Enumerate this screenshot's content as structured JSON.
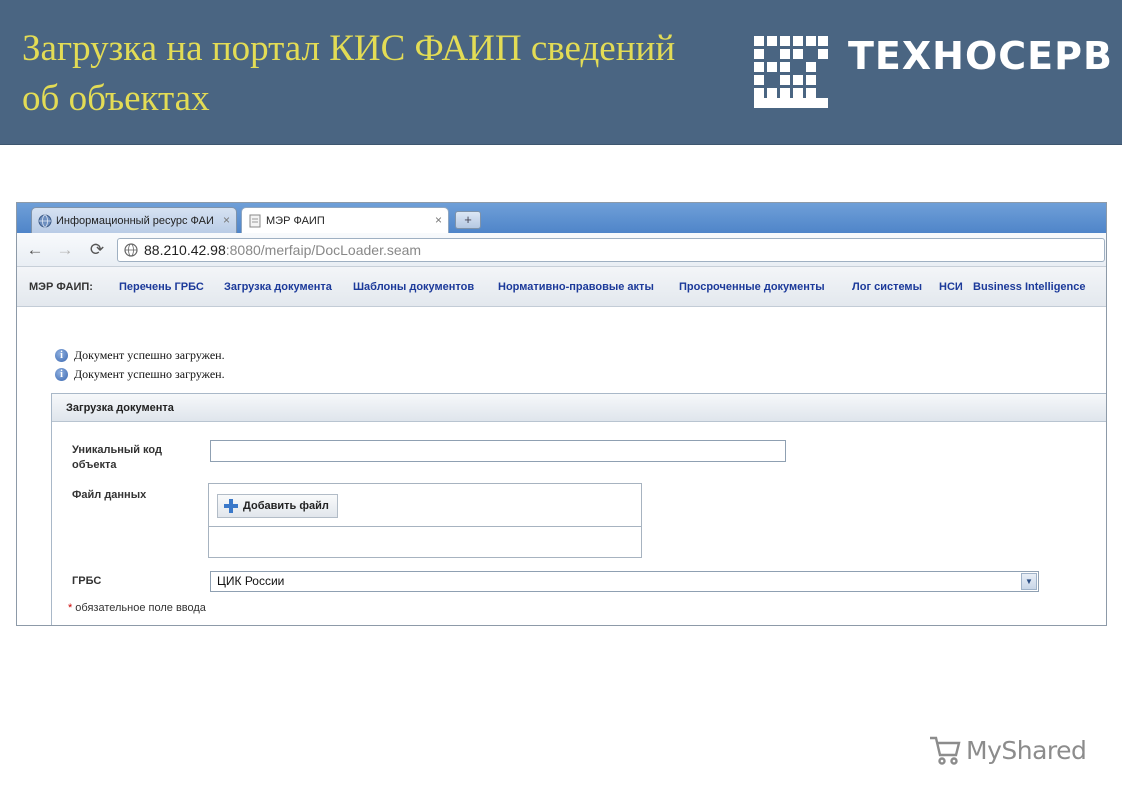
{
  "slide": {
    "title_line1": "Загрузка на портал КИС ФАИП сведений",
    "title_line2": "об объектах",
    "logo_text": "ТЕХНОСЕРВ",
    "title_color": "#e3dc55",
    "header_bg": "#4a6582"
  },
  "browser": {
    "tabs": [
      {
        "label": "Информационный ресурс ФАИ",
        "icon": "globe-icon",
        "active": false
      },
      {
        "label": "МЭР ФАИП",
        "icon": "page-icon",
        "active": true
      }
    ],
    "new_tab_symbol": "+",
    "close_symbol": "×",
    "address": {
      "host": "88.210.42.98",
      "rest": ":8080/merfaip/DocLoader.seam"
    }
  },
  "app_nav": {
    "title": "МЭР ФАИП:",
    "links": [
      "Перечень ГРБС",
      "Загрузка документа",
      "Шаблоны документов",
      "Нормативно-правовые акты",
      "Просроченные документы",
      "Лог системы",
      "НСИ",
      "Business Intelligence"
    ],
    "link_color": "#1c3a9a"
  },
  "messages": [
    "Документ успешно загружен.",
    "Документ успешно загружен."
  ],
  "form": {
    "panel_title": "Загрузка документа",
    "unique_code_label_1": "Уникальный код",
    "unique_code_label_2": "объекта",
    "unique_code_value": "",
    "file_label": "Файл данных",
    "add_file_button": "Добавить файл",
    "grbs_label": "ГРБС",
    "grbs_selected": "ЦИК России",
    "required_star": "*",
    "required_note": "обязательное поле ввода"
  },
  "watermark": {
    "text": "MyShared"
  }
}
